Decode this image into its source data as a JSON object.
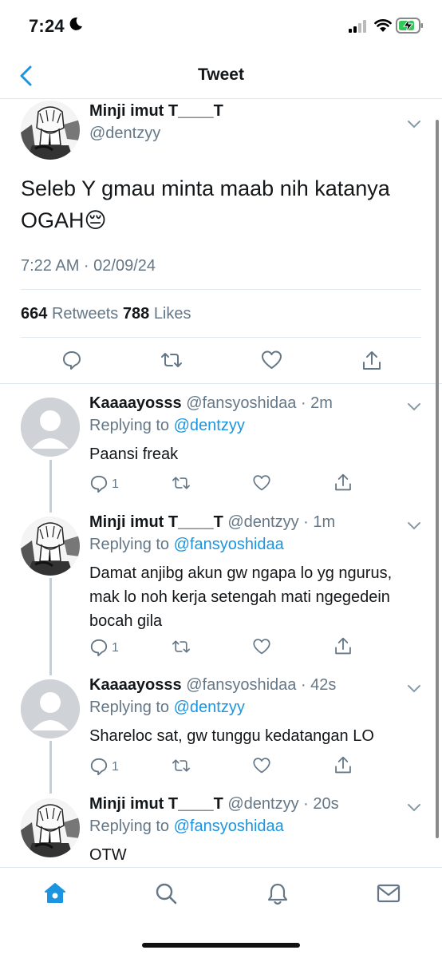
{
  "status_bar": {
    "time": "7:24"
  },
  "nav": {
    "title": "Tweet"
  },
  "main_tweet": {
    "name": "Minji imut T____T",
    "handle": "@dentzyy",
    "text": "Seleb Y gmau minta maab nih katanya OGAH😔",
    "timestamp": "7:22 AM · 02/09/24",
    "retweets": "664",
    "retweets_label": "Retweets",
    "likes": "788",
    "likes_label": "Likes"
  },
  "replies": [
    {
      "name": "Kaaaayosss",
      "meta": "@fansyoshidaa · 2m",
      "replying_label": "Replying to",
      "replying_to": "@dentzyy",
      "text": "Paansi freak",
      "reply_count": "1",
      "avatar": "default-avatar"
    },
    {
      "name": "Minji imut T____T",
      "meta": "@dentzyy · 1m",
      "replying_label": "Replying to",
      "replying_to": "@fansyoshidaa",
      "text": "Damat anjibg akun gw ngapa lo yg ngurus, mak lo noh kerja setengah mati ngegedein bocah gila",
      "reply_count": "1",
      "avatar": "manga-avatar"
    },
    {
      "name": "Kaaaayosss",
      "meta": "@fansyoshidaa · 42s",
      "replying_label": "Replying to",
      "replying_to": "@dentzyy",
      "text": "Shareloc sat, gw tunggu kedatangan LO",
      "reply_count": "1",
      "avatar": "default-avatar"
    },
    {
      "name": "Minji imut T____T",
      "meta": "@dentzyy · 20s",
      "replying_label": "Replying to",
      "replying_to": "@fansyoshidaa",
      "text": "OTW",
      "avatar": "manga-avatar"
    }
  ],
  "colors": {
    "accent": "#1b95e0",
    "secondary_text": "#657786",
    "divider": "#e1e8ed"
  },
  "icons": {
    "back": "chevron-left-icon",
    "reply": "comment-icon",
    "retweet": "retweet-icon",
    "like": "heart-icon",
    "share": "share-icon",
    "tabs": [
      "home-icon",
      "search-icon",
      "bell-icon",
      "mail-icon"
    ]
  }
}
